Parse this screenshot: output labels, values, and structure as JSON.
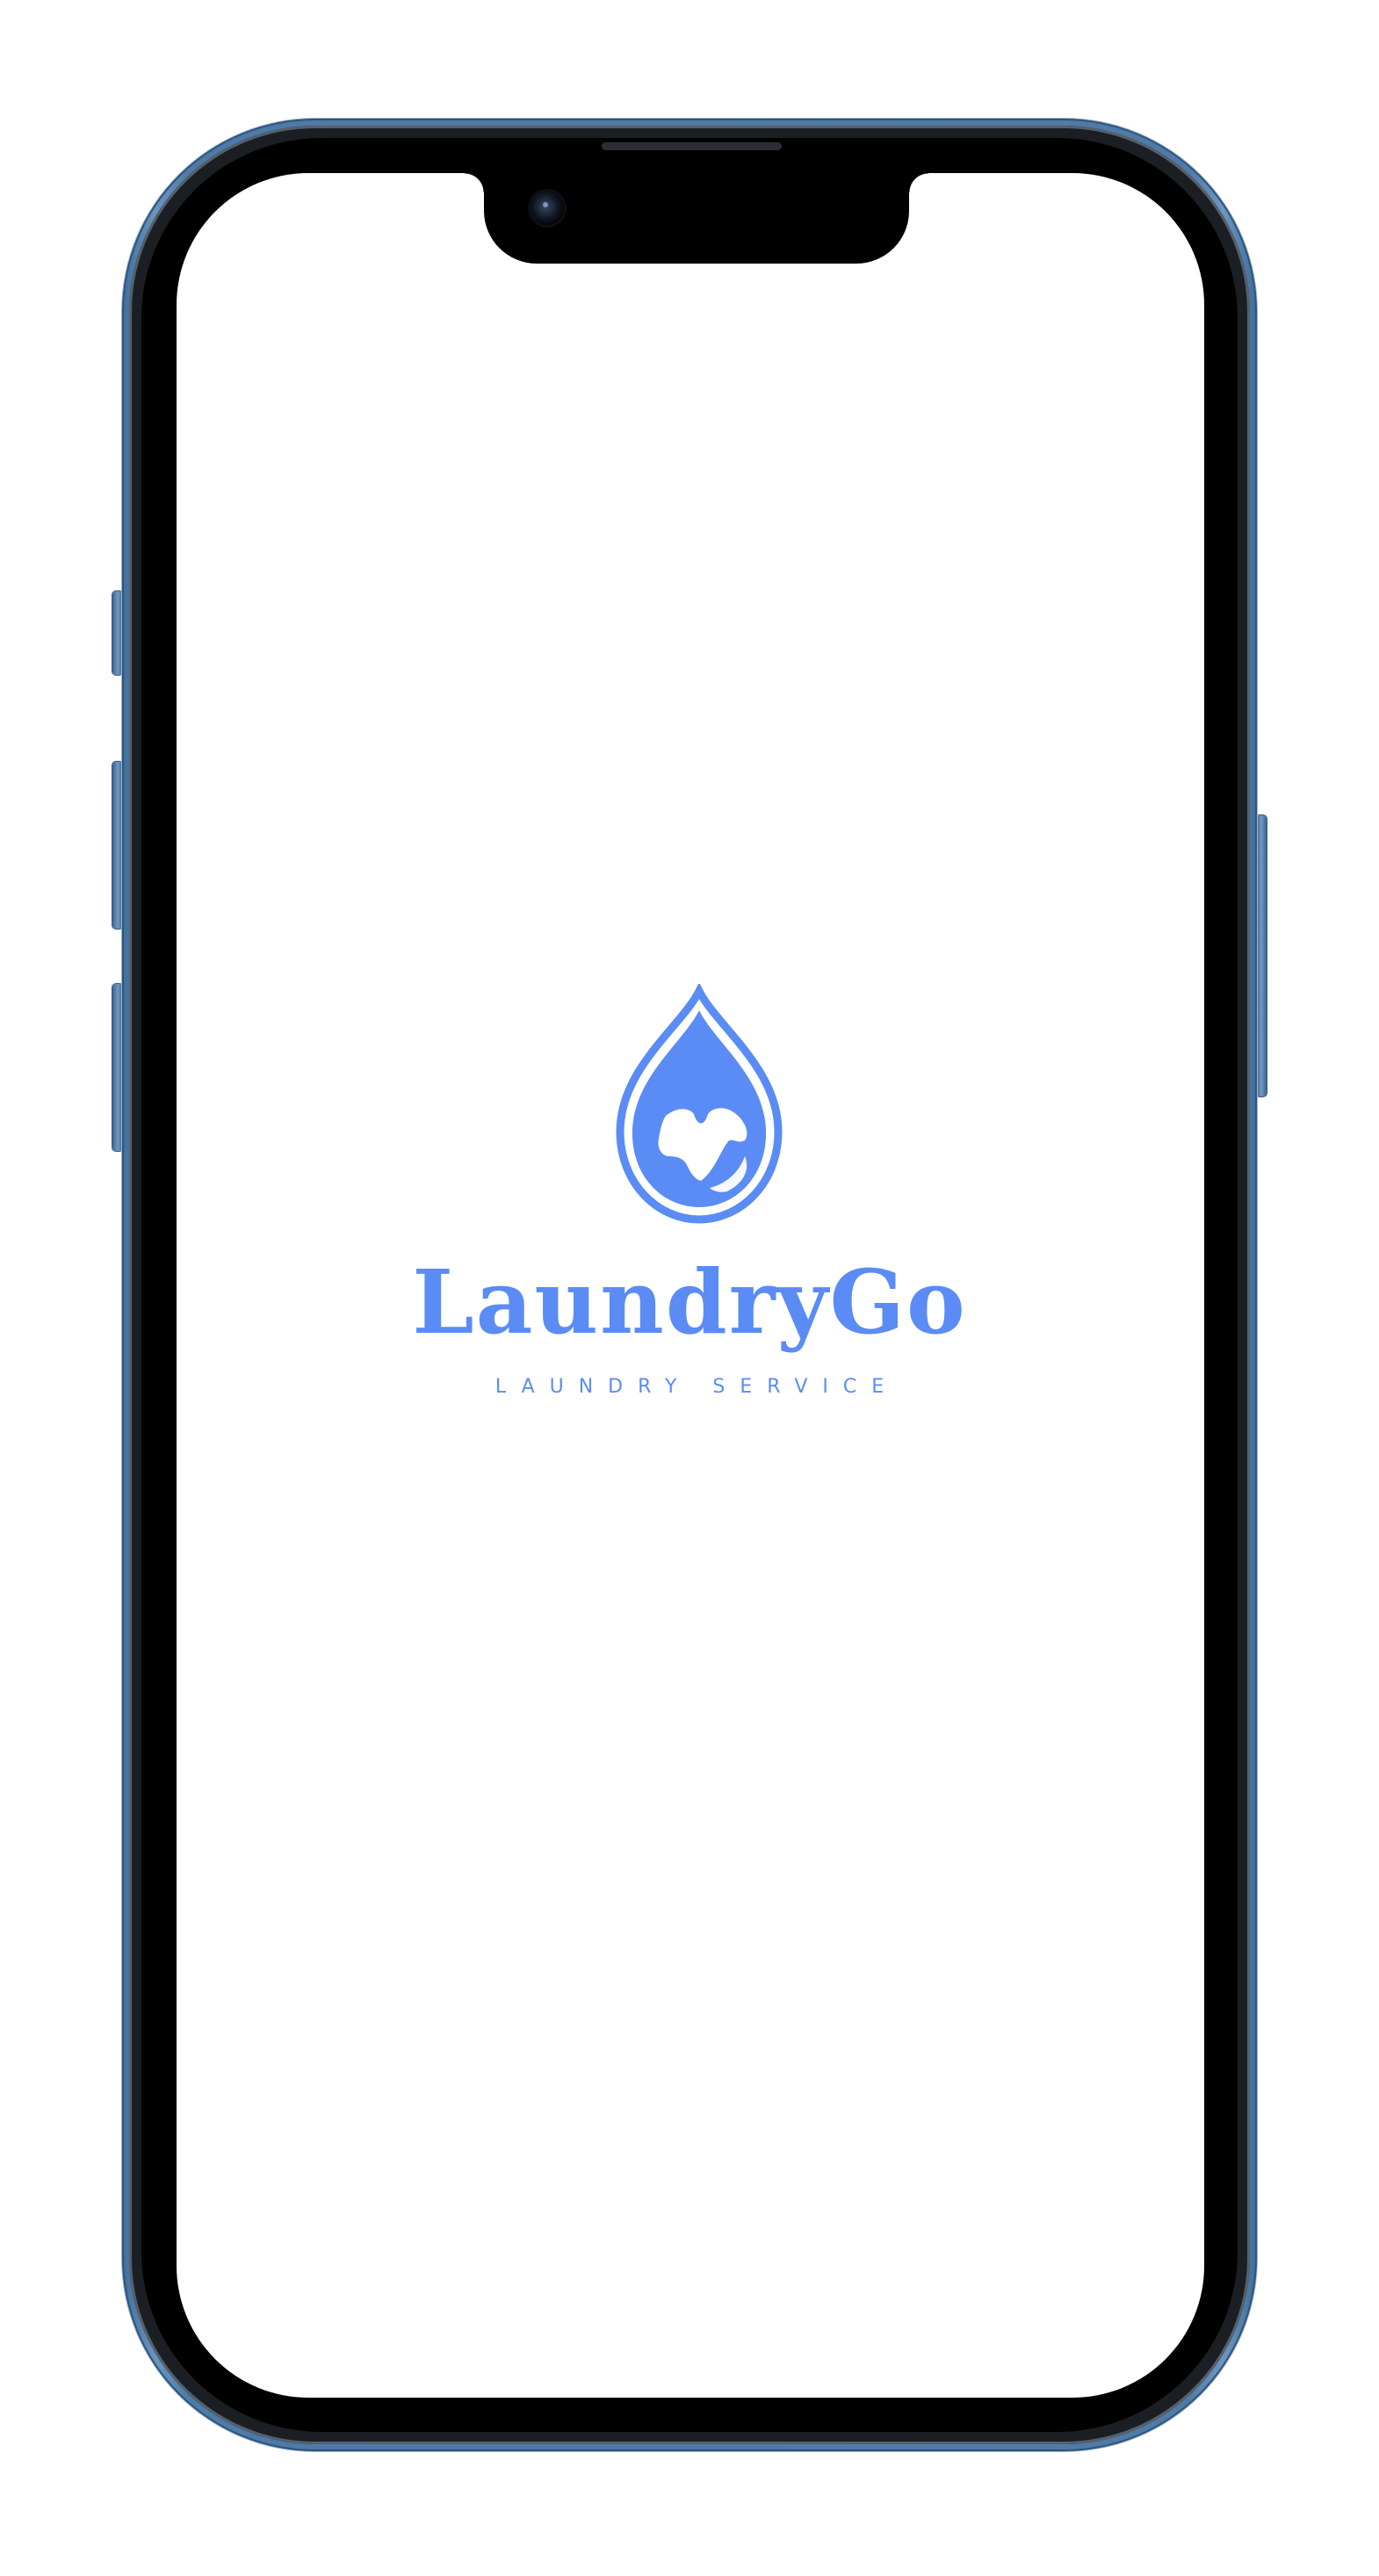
{
  "app": {
    "brand_name": "LaundryGo",
    "tagline": "LAUNDRY SERVICE",
    "logo_icon": "water-drop-shirt-icon"
  },
  "colors": {
    "brand_blue": "#5b8cf5",
    "screen_background": "#ffffff",
    "phone_frame": "#4f7ba6",
    "bezel": "#000000"
  }
}
